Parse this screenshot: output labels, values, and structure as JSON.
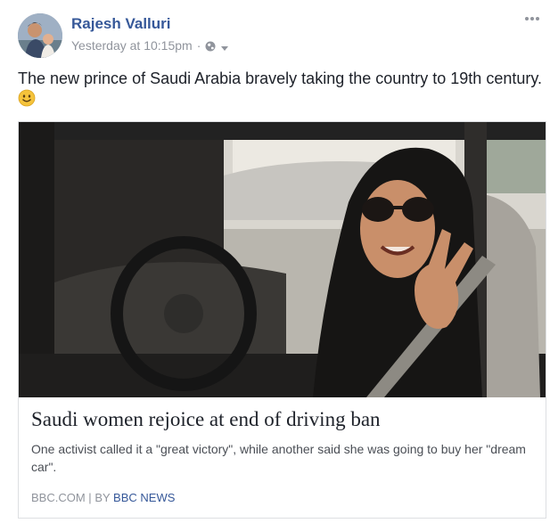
{
  "post": {
    "author": "Rajesh Valluri",
    "timestamp": "Yesterday at 10:15pm",
    "separator": "·",
    "privacy_icon": "globe-icon",
    "options_icon": "more-options-icon",
    "text": "The new prince of Saudi Arabia bravely taking the country to 19th century.",
    "emoji": "slightly-smiling-face"
  },
  "link_card": {
    "title": "Saudi women rejoice at end of driving ban",
    "description": "One activist called it a \"great victory\", while another said she was going to buy her \"dream car\".",
    "source_domain": "BBC.COM",
    "divider": "|",
    "by_prefix": "BY",
    "by_name": "BBC NEWS"
  },
  "colors": {
    "author_link": "#365899",
    "meta_grey": "#90949c",
    "text": "#1d2129",
    "card_border": "#dddfe2"
  }
}
